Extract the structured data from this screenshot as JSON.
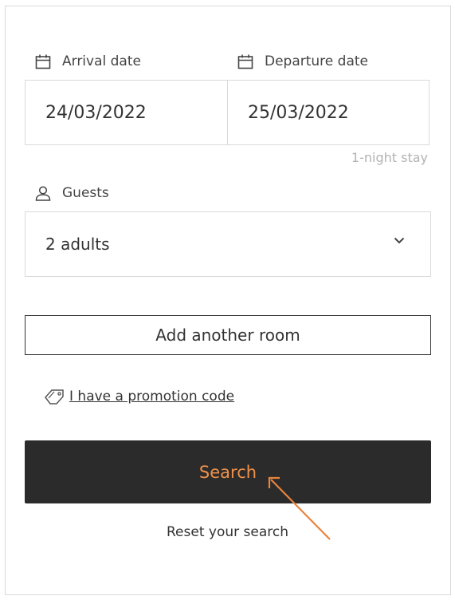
{
  "booking": {
    "arrival": {
      "label": "Arrival date",
      "value": "24/03/2022",
      "icon": "calendar-icon"
    },
    "departure": {
      "label": "Departure date",
      "value": "25/03/2022",
      "icon": "calendar-icon"
    },
    "stay_note": "1-night stay",
    "guests": {
      "label": "Guests",
      "value": "2 adults",
      "icon": "user-icon"
    },
    "add_room_label": "Add another room",
    "promo_label": "I have a promotion code",
    "search_label": "Search",
    "reset_label": "Reset your search"
  },
  "colors": {
    "accent": "#f0914a",
    "button_bg": "#2b2b2b",
    "border": "#d9d9d9",
    "muted_text": "#b3b3b3",
    "annotation_arrow": "#e8843c"
  }
}
